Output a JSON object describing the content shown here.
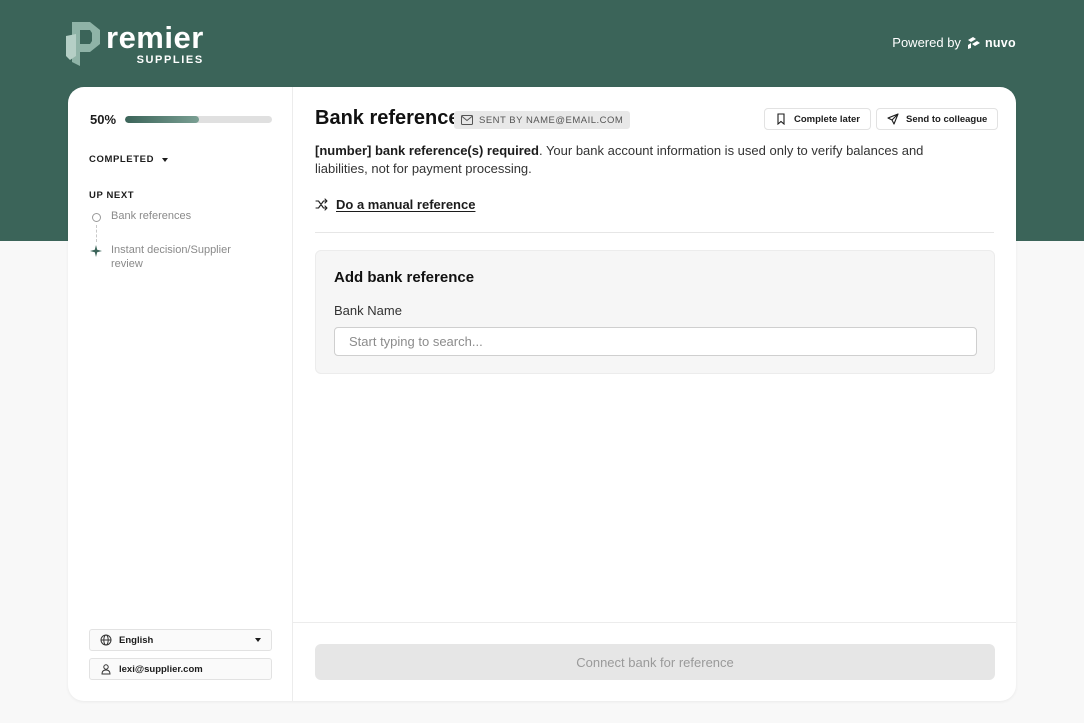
{
  "brand": {
    "logo_word": "remier",
    "logo_sub": "SUPPLIES",
    "powered_by": "Powered by",
    "partner_name": "nuvo",
    "colors": {
      "brand": "#3b6459",
      "background": "#f8f8f8"
    }
  },
  "sidebar": {
    "progress_label": "50%",
    "progress_value": 0.5,
    "completed_label": "COMPLETED",
    "up_next_label": "UP NEXT",
    "steps": [
      {
        "label": "Bank references",
        "icon": "circle-outline-icon"
      },
      {
        "label": "Instant decision/Supplier review",
        "icon": "sparkle-icon"
      }
    ],
    "language": {
      "value": "English",
      "icon": "globe-icon"
    },
    "user": {
      "email": "lexi@supplier.com",
      "icon": "user-icon"
    }
  },
  "main": {
    "title": "Bank reference",
    "sent_badge": "SENT BY NAME@EMAIL.COM",
    "complete_later": "Complete later",
    "send_to_colleague": "Send to colleague",
    "description_bold": "[number] bank reference(s) required",
    "description_rest": ". Your bank account information is used only to verify balances and liabilities, not for payment processing.",
    "manual_link": "Do a manual reference",
    "panel": {
      "title": "Add bank reference",
      "field_label": "Bank Name",
      "field_value": "",
      "placeholder": "Start typing to search..."
    },
    "connect_button": "Connect bank for reference"
  }
}
